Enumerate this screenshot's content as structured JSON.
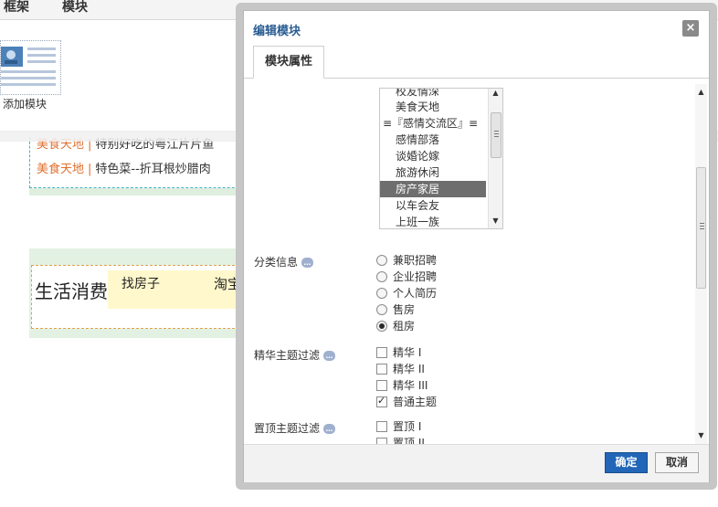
{
  "background": {
    "menu": [
      "框架",
      "模块"
    ],
    "add_module_label": "添加模块",
    "news": [
      {
        "category": "美食天地",
        "title": "特别好吃的粤江片片鱼"
      },
      {
        "category": "美食天地",
        "title": "特色菜--折耳根炒腊肉"
      }
    ],
    "separator": "|",
    "life_title": "生活消费",
    "link_a": "找房子",
    "link_b": "淘宝"
  },
  "dialog": {
    "title": "编辑模块",
    "close": "×",
    "tab": "模块属性",
    "listbox_items": [
      "校友情深",
      "美食天地",
      "≡『感情交流区』≡",
      "感情部落",
      "谈婚论嫁",
      "旅游休闲",
      "房产家居",
      "以车会友",
      "上班一族"
    ],
    "listbox_selected": "房产家居",
    "classify": {
      "label": "分类信息",
      "options": [
        "兼职招聘",
        "企业招聘",
        "个人简历",
        "售房",
        "租房"
      ],
      "selected": "租房"
    },
    "digest": {
      "label": "精华主题过滤",
      "options": [
        "精华 I",
        "精华 II",
        "精华 III",
        "普通主题"
      ],
      "checked": [
        false,
        false,
        false,
        true
      ]
    },
    "sticky": {
      "label": "置顶主题过滤",
      "options": [
        "置顶 I",
        "置顶 II"
      ],
      "checked": [
        false,
        false
      ]
    },
    "ok_label": "确定",
    "cancel_label": "取消"
  },
  "colors": {
    "title": "#2a5d93",
    "accent": "#2266b8",
    "category": "#e07030",
    "selected_item": "#6e6e6e"
  }
}
